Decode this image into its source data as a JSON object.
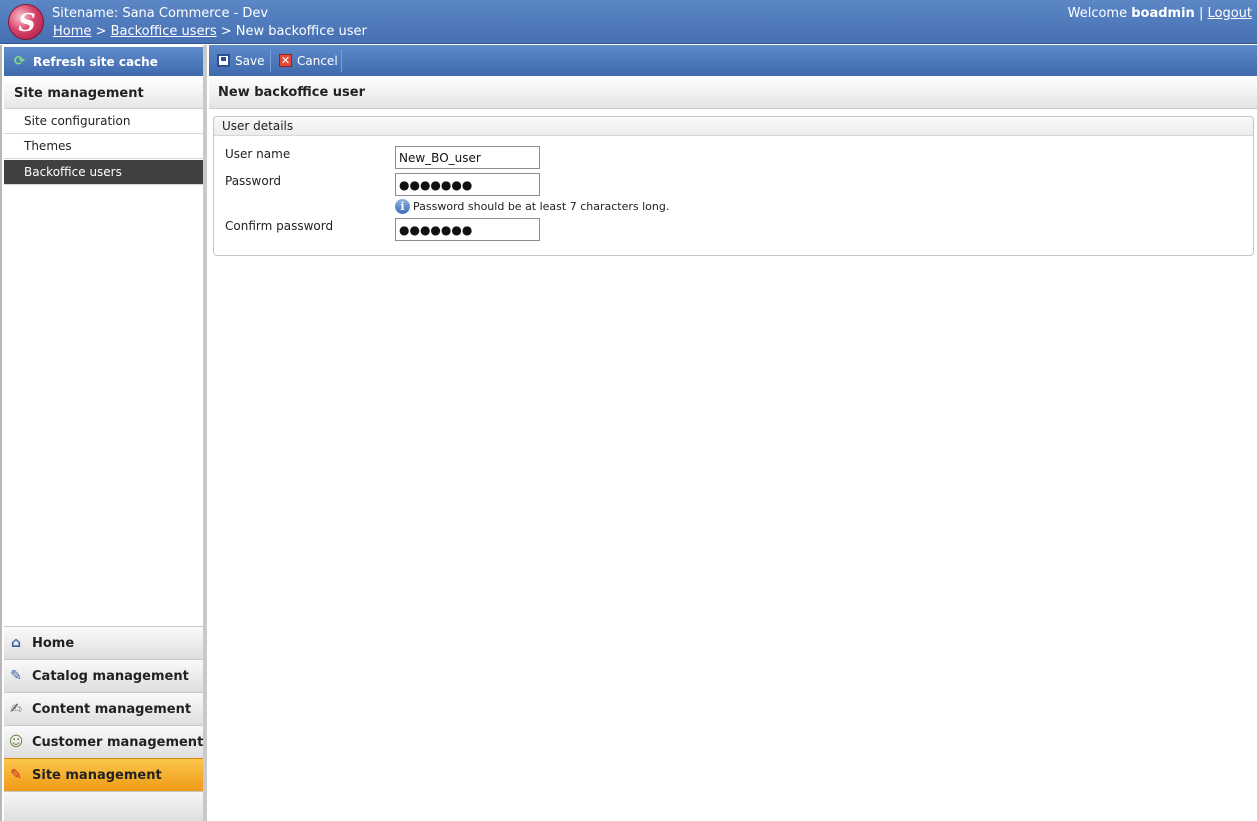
{
  "header": {
    "sitename": "Sitename: Sana Commerce - Dev",
    "breadcrumb": {
      "home": "Home",
      "sep1": ">",
      "backoffice_users": "Backoffice users",
      "sep2": ">",
      "current": "New backoffice user"
    },
    "welcome_prefix": "Welcome",
    "username": "boadmin",
    "divider": "|",
    "logout": "Logout"
  },
  "sidebar": {
    "refresh_label": "Refresh site cache",
    "section_title": "Site management",
    "items": [
      {
        "label": "Site configuration",
        "active": false
      },
      {
        "label": "Themes",
        "active": false
      },
      {
        "label": "Backoffice users",
        "active": true
      }
    ],
    "nav": [
      {
        "label": "Home",
        "icon": "home-icon"
      },
      {
        "label": "Catalog management",
        "icon": "catalog-icon"
      },
      {
        "label": "Content management",
        "icon": "content-icon"
      },
      {
        "label": "Customer management",
        "icon": "customers-icon"
      },
      {
        "label": "Site management",
        "icon": "site-icon",
        "active": true
      }
    ]
  },
  "toolbar": {
    "save_label": "Save",
    "cancel_label": "Cancel"
  },
  "page": {
    "title": "New backoffice user",
    "fieldset_legend": "User details",
    "fields": {
      "username_label": "User name",
      "username_value": "New_BO_user",
      "password_label": "Password",
      "password_value": "●●●●●●●",
      "password_hint": "Password should be at least 7 characters long.",
      "confirm_label": "Confirm password",
      "confirm_value": "●●●●●●●"
    }
  },
  "colors": {
    "header_blue": "#4670b2",
    "active_item": "#404040",
    "active_nav": "#f09a17"
  }
}
